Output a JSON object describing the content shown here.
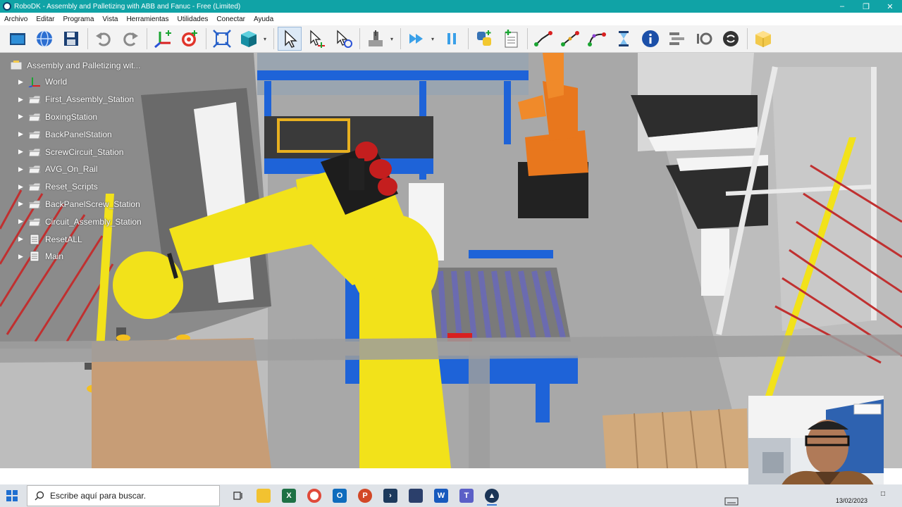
{
  "window": {
    "title": "RoboDK - Assembly and Palletizing with ABB and Fanuc - Free (Limited)"
  },
  "menu": [
    "Archivo",
    "Editar",
    "Programa",
    "Vista",
    "Herramientas",
    "Utilidades",
    "Conectar",
    "Ayuda"
  ],
  "toolbar_icons": [
    "open-icon",
    "web-library-icon",
    "save-icon",
    "undo-icon",
    "redo-icon",
    "add-reference-frame-icon",
    "add-target-icon",
    "fit-all-icon",
    "iso-view-icon",
    "select-icon",
    "move-reference-icon",
    "move-tool-icon",
    "reset-view-icon",
    "run-program-icon",
    "pause-icon",
    "python-icon",
    "add-program-icon",
    "move-joint-icon",
    "move-linear-icon",
    "move-circular-icon",
    "pause-instruction-icon",
    "info-icon",
    "set-variable-icon",
    "io-icon",
    "loop-icon",
    "package-icon"
  ],
  "tree": {
    "root": "Assembly and Palletizing wit...",
    "items": [
      {
        "label": "World",
        "icon": "reference-frame-icon"
      },
      {
        "label": "First_Assembly_Station",
        "icon": "folder-icon"
      },
      {
        "label": "BoxingStation",
        "icon": "folder-icon"
      },
      {
        "label": "BackPanelStation",
        "icon": "folder-icon"
      },
      {
        "label": "ScrewCircuit_Station",
        "icon": "folder-icon"
      },
      {
        "label": "AVG_On_Rail",
        "icon": "folder-icon"
      },
      {
        "label": "Reset_Scripts",
        "icon": "folder-icon"
      },
      {
        "label": "BackPanelScrew_Station",
        "icon": "folder-icon"
      },
      {
        "label": "Circuit_Assembly_Station",
        "icon": "folder-icon"
      },
      {
        "label": "ResetALL",
        "icon": "program-icon"
      },
      {
        "label": "Main",
        "icon": "program-icon"
      }
    ]
  },
  "taskbar": {
    "search_placeholder": "Escribe aquí para buscar.",
    "apps": [
      "task-view-icon",
      "file-explorer-icon",
      "excel-icon",
      "chrome-icon",
      "outlook-icon",
      "powerpoint-icon",
      "terminal-icon",
      "save-app-icon",
      "word-icon",
      "teams-icon",
      "robodk-icon"
    ],
    "date": "13/02/2023"
  },
  "colors": {
    "titlebar": "#10a3a6",
    "robot_yellow": "#f2e21a",
    "robot_orange": "#e8771d",
    "conveyor_blue": "#1e63d8"
  }
}
